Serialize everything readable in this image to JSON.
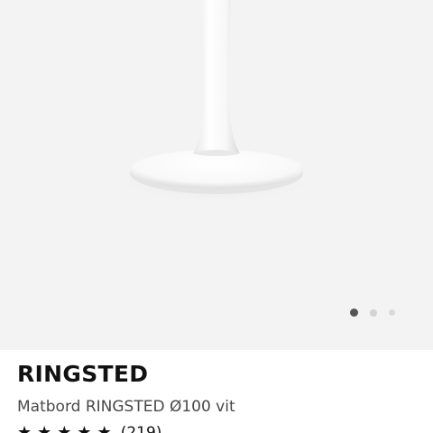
{
  "product": {
    "brand": "RINGSTED",
    "description": "Matbord RINGSTED Ø100 vit",
    "rating": {
      "stars": 5,
      "review_count": "(219)"
    }
  },
  "gallery": {
    "page_count": 3,
    "active_page": 1,
    "image_icon": "white-pedestal-table-image"
  },
  "colors": {
    "gallery_background": "#f3f3f3",
    "active_dot": "#555555",
    "inactive_dot": "#d6d6d6",
    "text_primary": "#111111",
    "text_secondary": "#484848"
  }
}
